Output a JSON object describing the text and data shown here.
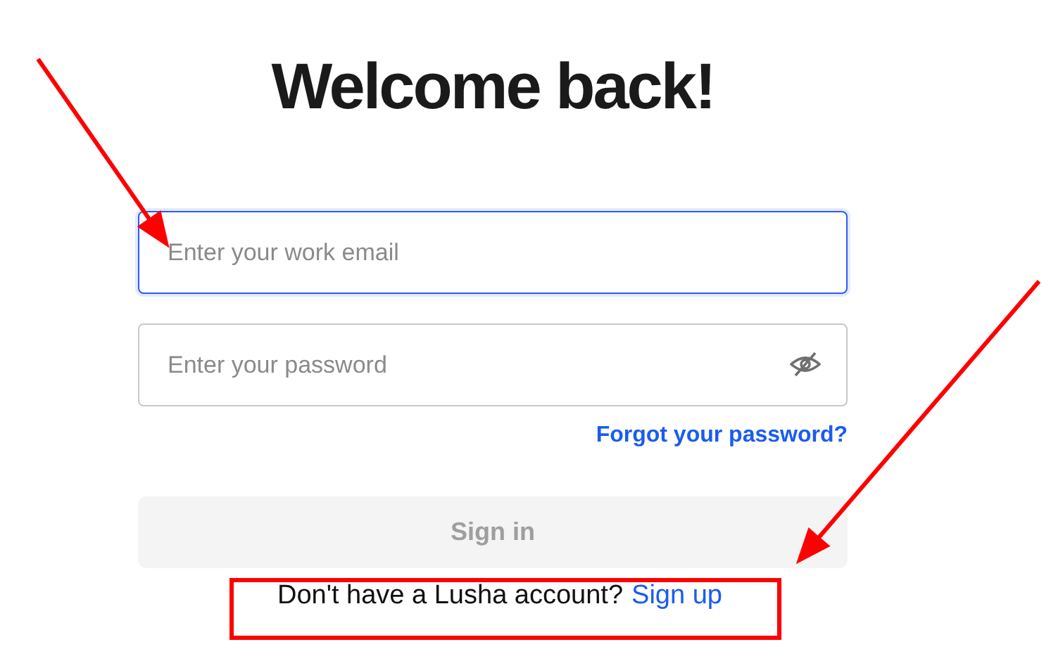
{
  "title": "Welcome back!",
  "email_field": {
    "placeholder": "Enter your work email",
    "focused": true
  },
  "password_field": {
    "placeholder": "Enter your password",
    "focused": false
  },
  "forgot_link": "Forgot your password?",
  "sign_in_button": {
    "label": "Sign in",
    "disabled": true
  },
  "signup_prompt": {
    "text": "Don't have a Lusha account?",
    "link": "Sign up"
  }
}
